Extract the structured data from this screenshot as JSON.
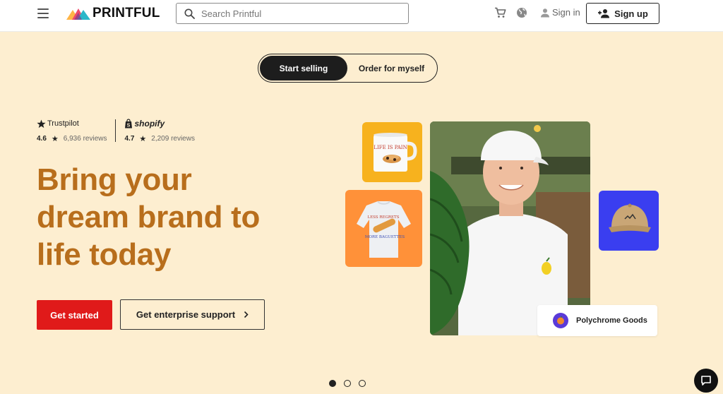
{
  "header": {
    "logo_text": "PRINTFUL",
    "search": {
      "placeholder": "Search Printful"
    },
    "signin_label": "Sign in",
    "signup_label": "Sign up"
  },
  "toggle": {
    "options": [
      "Start selling",
      "Order for myself"
    ],
    "active": "Start selling"
  },
  "reviews": {
    "trustpilot": {
      "brand": "Trustpilot",
      "score": "4.6",
      "count": "6,936 reviews"
    },
    "shopify": {
      "brand": "shopify",
      "score": "4.7",
      "count": "2,209 reviews"
    }
  },
  "hero": {
    "headline_lines": [
      "Bring your",
      "dream brand to",
      "life today"
    ],
    "cta_primary": "Get started",
    "cta_secondary": "Get enterprise support"
  },
  "collage": {
    "mug_text": "LIFE IS PAIN",
    "sweatshirt_text_top": "LESS REGRETS",
    "sweatshirt_text_bottom": "MORE BAGUETTES",
    "store_name": "Polychrome Goods"
  },
  "carousel": {
    "count": 3,
    "active_index": 0
  },
  "colors": {
    "hero_bg": "#fdeed0",
    "headline": "#b86e1c",
    "primary_cta": "#e01a1a",
    "mug_tile": "#f7b21e",
    "sweat_tile": "#ff9139",
    "cap_tile": "#3a3ef0"
  },
  "icons": [
    "menu-icon",
    "search-icon",
    "cart-icon",
    "globe-icon",
    "user-icon",
    "add-user-icon",
    "star-icon",
    "shopify-bag-icon",
    "chevron-right-icon",
    "chat-icon"
  ]
}
